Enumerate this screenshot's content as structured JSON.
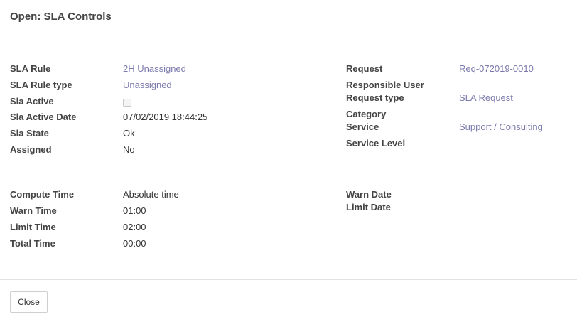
{
  "dialog": {
    "title": "Open: SLA Controls"
  },
  "left1": {
    "sla_rule": {
      "label": "SLA Rule",
      "value": "2H Unassigned"
    },
    "sla_rule_type": {
      "label": "SLA Rule type",
      "value": "Unassigned"
    },
    "sla_active": {
      "label": "Sla Active",
      "checked": false
    },
    "sla_active_date": {
      "label": "Sla Active Date",
      "value": "07/02/2019 18:44:25"
    },
    "sla_state": {
      "label": "Sla State",
      "value": "Ok"
    },
    "assigned": {
      "label": "Assigned",
      "value": "No"
    }
  },
  "right1": {
    "request": {
      "label": "Request",
      "value": "Req-072019-0010"
    },
    "responsible_user": {
      "label": "Responsible User",
      "value": ""
    },
    "request_type": {
      "label": "Request type",
      "value": "SLA Request"
    },
    "category": {
      "label": "Category",
      "value": ""
    },
    "service": {
      "label": "Service",
      "value": "Support / Consulting"
    },
    "service_level": {
      "label": "Service Level",
      "value": ""
    }
  },
  "left2": {
    "compute_time": {
      "label": "Compute Time",
      "value": "Absolute time"
    },
    "warn_time": {
      "label": "Warn Time",
      "value": "01:00"
    },
    "limit_time": {
      "label": "Limit Time",
      "value": "02:00"
    },
    "total_time": {
      "label": "Total Time",
      "value": "00:00"
    }
  },
  "right2": {
    "warn_date": {
      "label": "Warn Date",
      "value": ""
    },
    "limit_date": {
      "label": "Limit Date",
      "value": ""
    }
  },
  "footer": {
    "close_label": "Close"
  },
  "colors": {
    "link": "#7c7bad",
    "label": "#444444",
    "border": "#e2e2e2"
  }
}
